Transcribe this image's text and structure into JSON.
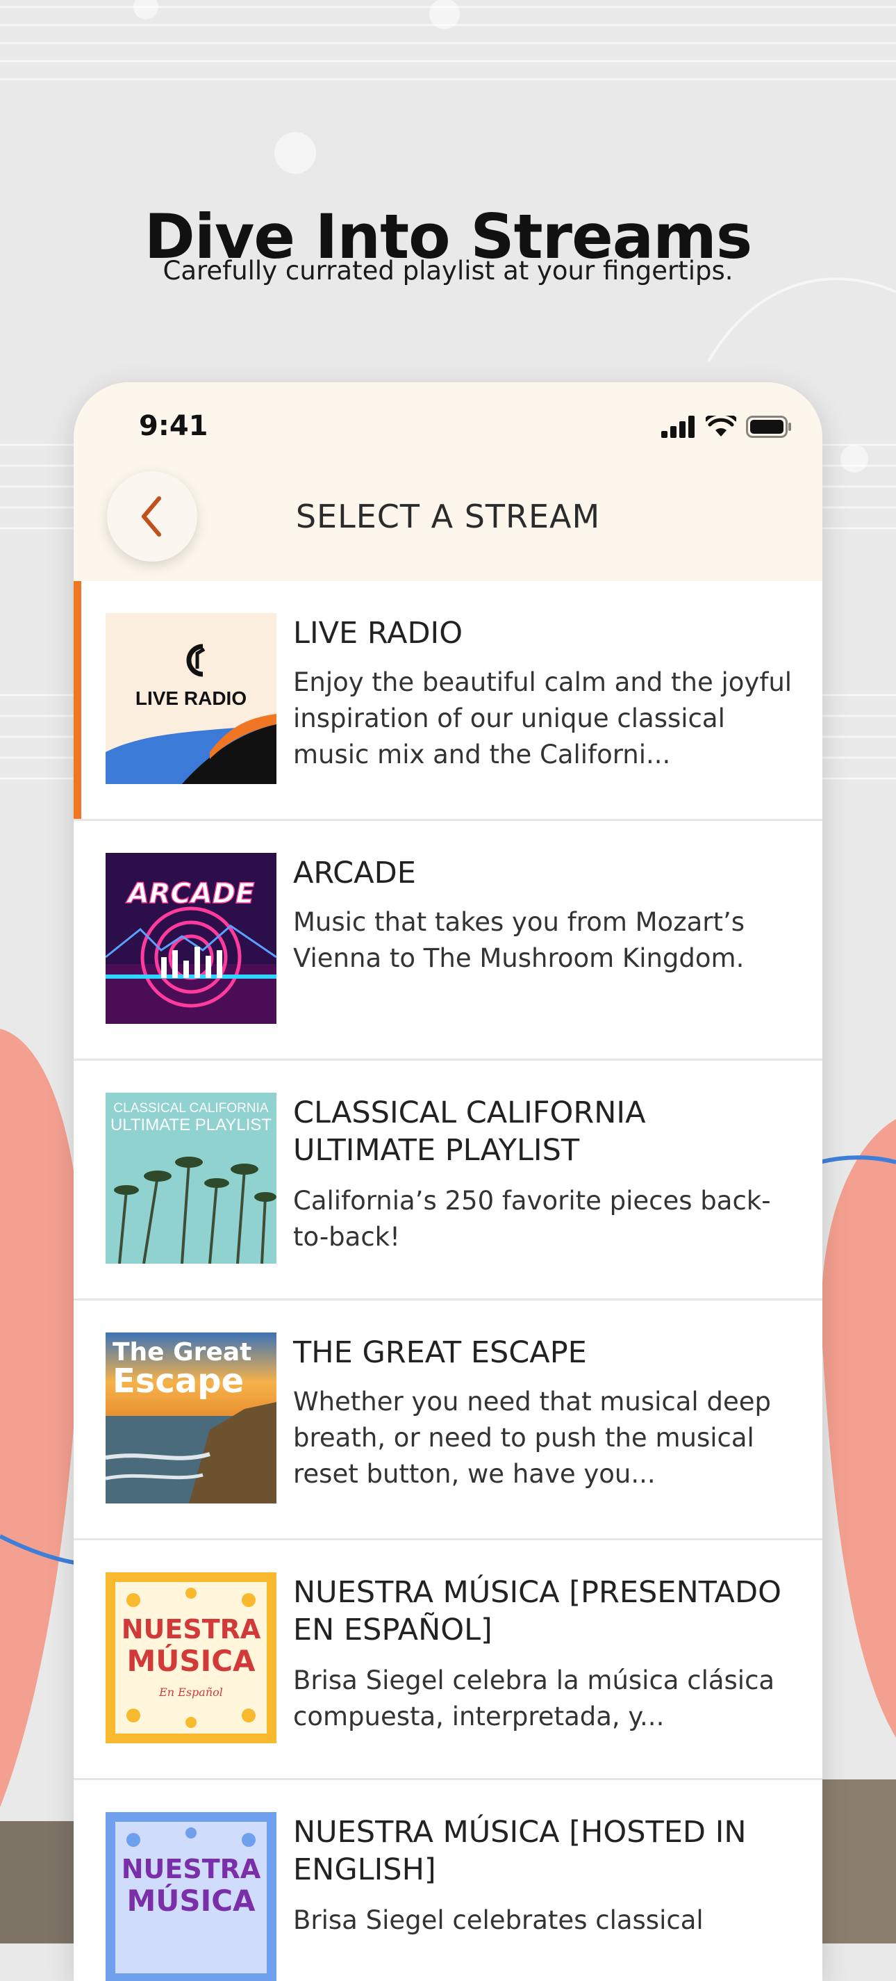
{
  "hero": {
    "title": "Dive Into Streams",
    "subtitle": "Carefully currated playlist at your fingertips."
  },
  "status_bar": {
    "time": "9:41"
  },
  "header": {
    "title": "SELECT A STREAM"
  },
  "streams": [
    {
      "title": "LIVE RADIO",
      "description": "Enjoy the beautiful calm and the joyful inspiration of our unique classical music mix and the Californi...",
      "thumb_text": "LIVE RADIO",
      "active": true
    },
    {
      "title": "ARCADE",
      "description": "Music that takes you from Mozart’s Vienna to The Mushroom Kingdom.",
      "thumb_text": "ARCADE"
    },
    {
      "title": "CLASSICAL CALIFORNIA ULTIMATE PLAYLIST",
      "description": "California’s 250 favorite pieces back-to-back!",
      "thumb_text_1": "CLASSICAL CALIFORNIA",
      "thumb_text_2": "ULTIMATE PLAYLIST"
    },
    {
      "title": "THE GREAT ESCAPE",
      "description": "Whether you need that musical deep breath, or need to push the musical reset button, we have you...",
      "thumb_text_1": "The Great",
      "thumb_text_2": "Escape"
    },
    {
      "title": "NUESTRA MÚSICA [PRESENTADO EN ESPAÑOL]",
      "description": "Brisa Siegel celebra la música clásica compuesta, interpretada, y...",
      "thumb_text_1": "NUESTRA",
      "thumb_text_2": "MÚSICA",
      "thumb_text_3": "En Español"
    },
    {
      "title": "NUESTRA MÚSICA [HOSTED IN ENGLISH]",
      "description": "Brisa Siegel celebrates classical",
      "thumb_text_1": "NUESTRA",
      "thumb_text_2": "MÚSICA"
    }
  ],
  "colors": {
    "accent": "#f07623",
    "header_bg": "#fdf6ec",
    "back_chevron": "#c0501c",
    "coral": "#f4a090",
    "blue_line": "#3f7fd8"
  },
  "icons": [
    "chevron-left-icon",
    "cellular-signal-icon",
    "wifi-icon",
    "battery-icon"
  ]
}
